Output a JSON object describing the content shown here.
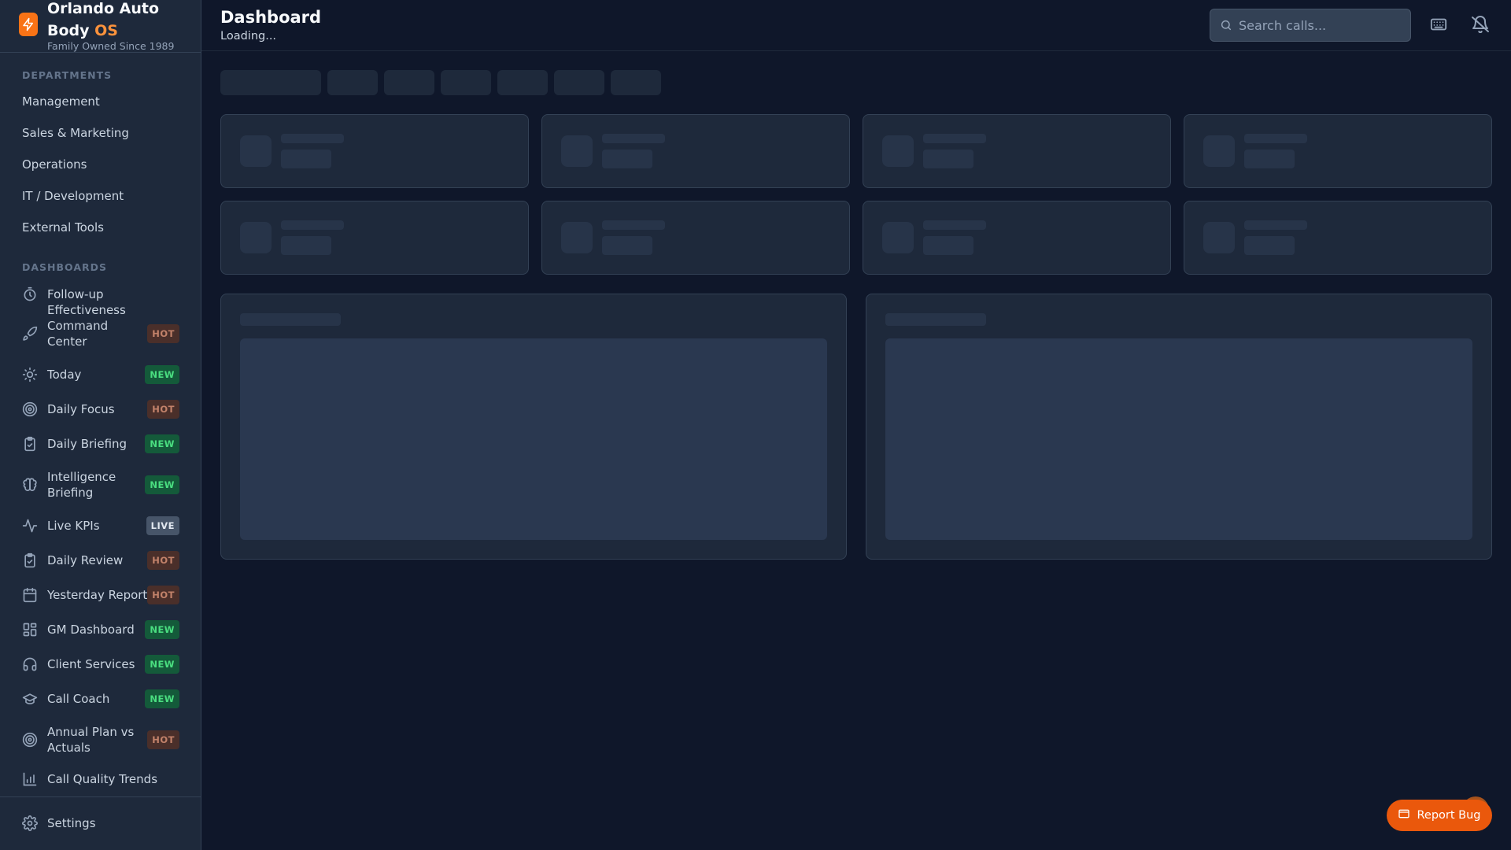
{
  "brand": {
    "name_line": "Orlando Auto Body",
    "name_accent": "OS",
    "tagline": "Family Owned Since 1989"
  },
  "sidebar": {
    "departments_label": "DEPARTMENTS",
    "departments": [
      "Management",
      "Sales & Marketing",
      "Operations",
      "IT / Development",
      "External Tools"
    ],
    "dashboards_label": "DASHBOARDS",
    "dashboards": [
      {
        "label": "Follow-up Effectiveness",
        "icon": "timer-icon",
        "badge": ""
      },
      {
        "label": "Command Center",
        "icon": "rocket-icon",
        "badge": "HOT"
      },
      {
        "label": "Today",
        "icon": "sun-icon",
        "badge": "NEW"
      },
      {
        "label": "Daily Focus",
        "icon": "target-icon",
        "badge": "HOT"
      },
      {
        "label": "Daily Briefing",
        "icon": "clipboard-check-icon",
        "badge": "NEW"
      },
      {
        "label": "Intelligence Briefing",
        "icon": "brain-icon",
        "badge": "NEW"
      },
      {
        "label": "Live KPIs",
        "icon": "activity-icon",
        "badge": "LIVE"
      },
      {
        "label": "Daily Review",
        "icon": "clipboard-check-icon",
        "badge": "HOT"
      },
      {
        "label": "Yesterday Report",
        "icon": "calendar-icon",
        "badge": "HOT"
      },
      {
        "label": "GM Dashboard",
        "icon": "layout-dashboard-icon",
        "badge": "NEW"
      },
      {
        "label": "Client Services",
        "icon": "headphones-icon",
        "badge": "NEW"
      },
      {
        "label": "Call Coach",
        "icon": "graduation-cap-icon",
        "badge": "NEW"
      },
      {
        "label": "Annual Plan vs Actuals",
        "icon": "target-icon",
        "badge": "HOT"
      },
      {
        "label": "Call Quality Trends",
        "icon": "bar-chart-icon",
        "badge": ""
      }
    ],
    "settings_label": "Settings"
  },
  "header": {
    "title": "Dashboard",
    "subtitle": "Loading...",
    "search_placeholder": "Search calls..."
  },
  "report_bug_label": "Report Bug",
  "colors": {
    "accent": "#f97316",
    "background": "#0f172a",
    "sidebar": "#1e293b",
    "badge_hot": "#c2826a",
    "badge_new": "#4ade80"
  }
}
